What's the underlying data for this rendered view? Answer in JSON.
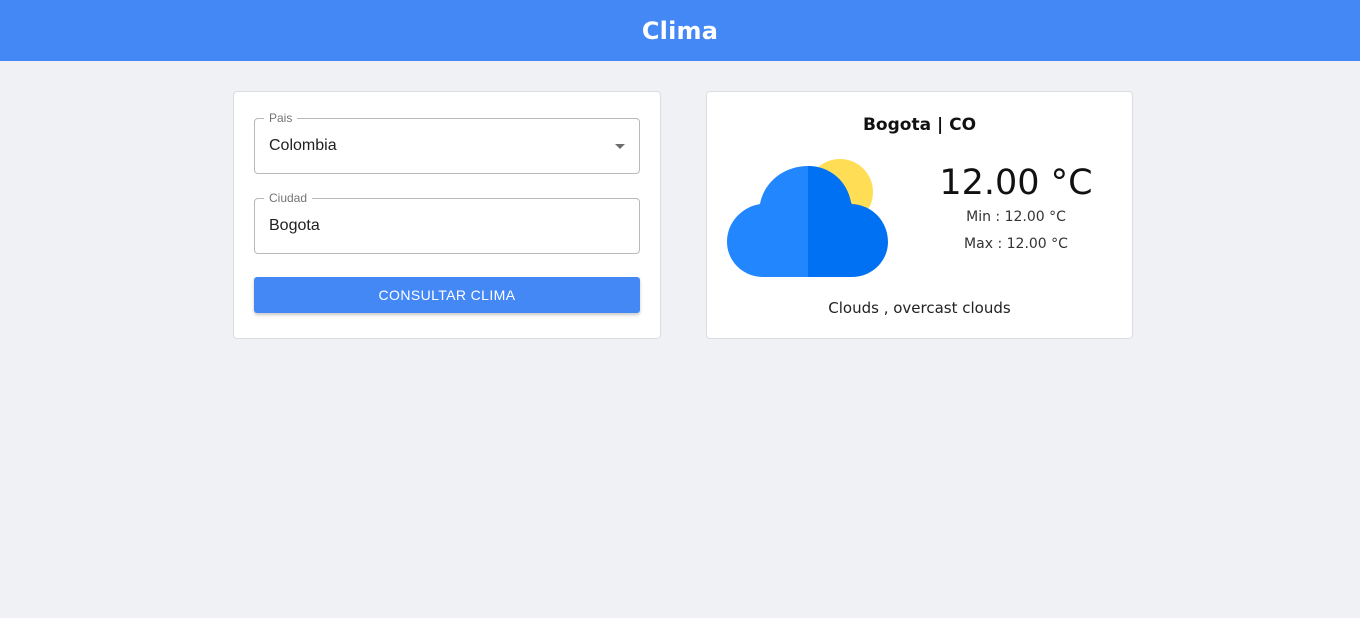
{
  "header": {
    "title": "Clima"
  },
  "form": {
    "country": {
      "label": "Pais",
      "value": "Colombia"
    },
    "city": {
      "label": "Ciudad",
      "value": "Bogota"
    },
    "submit_label": "CONSULTAR CLIMA"
  },
  "weather": {
    "city": "Bogota",
    "separator": "|",
    "country_code": "CO",
    "icon": "cloud-with-sun-icon",
    "temperature": "12.00 °C",
    "min_label": "Min :",
    "min_value": "12.00 °C",
    "max_label": "Max :",
    "max_value": "12.00 °C",
    "description": "Clouds , overcast clouds"
  },
  "colors": {
    "primary": "#4488f6",
    "background": "#f0f1f5",
    "cloud_light": "#2287fe",
    "cloud_dark": "#0071f2",
    "sun": "#ffdd55"
  }
}
